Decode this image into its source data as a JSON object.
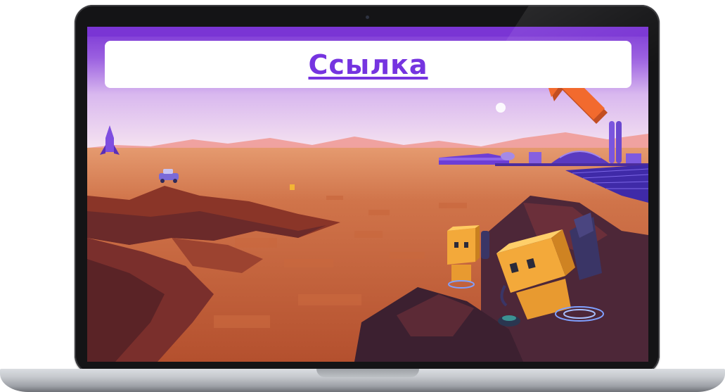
{
  "banner": {
    "link_label": "Ссылка"
  },
  "colors": {
    "link": "#7534e0",
    "sky_top": "#7a35d4",
    "desert": "#c55e35",
    "robot": "#f3a93a",
    "arrow": "#f26a2e"
  },
  "icons": {
    "pointer_arrow": "arrow-up-left-icon",
    "camera": "webcam-icon"
  }
}
